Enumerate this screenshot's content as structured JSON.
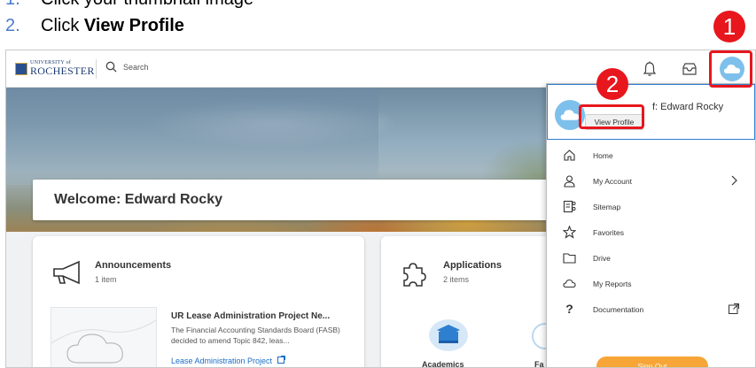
{
  "instructions": [
    {
      "number": "1.",
      "text_plain": "Click your thumbnail image",
      "text_bold": ""
    },
    {
      "number": "2.",
      "text_plain": "Click ",
      "text_bold": "View Profile"
    }
  ],
  "markers": [
    "1",
    "2"
  ],
  "topbar": {
    "logo_small": "UNIVERSITY of",
    "logo_text": "ROCHESTER",
    "search_placeholder": "Search",
    "icons": [
      "bell-icon",
      "inbox-icon",
      "avatar"
    ]
  },
  "welcome": {
    "title": "Welcome: Edward Rocky"
  },
  "announcements": {
    "title": "Announcements",
    "count": "1 item",
    "item_title": "UR Lease Administration Project Ne...",
    "item_desc": "The Financial Accounting Standards Board (FASB) decided to amend Topic 842, leas...",
    "item_link": "Lease Administration Project"
  },
  "applications": {
    "title": "Applications",
    "count": "2 items",
    "apps": [
      "Academics",
      "Fa"
    ]
  },
  "menu": {
    "header_name_visible": "f: Edward Rocky",
    "view_profile": "View Profile",
    "items": [
      {
        "label": "Home",
        "icon": "home-icon",
        "right": ""
      },
      {
        "label": "My Account",
        "icon": "person-icon",
        "right": "chevron-right-icon"
      },
      {
        "label": "Sitemap",
        "icon": "sitemap-icon",
        "right": ""
      },
      {
        "label": "Favorites",
        "icon": "star-icon",
        "right": ""
      },
      {
        "label": "Drive",
        "icon": "folder-icon",
        "right": ""
      },
      {
        "label": "My Reports",
        "icon": "cloud-icon",
        "right": ""
      },
      {
        "label": "Documentation",
        "icon": "question-icon",
        "right": "external-link-icon"
      }
    ],
    "sign_out": "Sign Out"
  },
  "colors": {
    "annotation_red": "#e8161d",
    "instruction_number_blue": "#4a7bd0",
    "sign_out_orange": "#f7a536",
    "header_border_blue": "#2e7fcf",
    "avatar_blue": "#7ec0ec",
    "link_blue": "#1a6ec7"
  }
}
